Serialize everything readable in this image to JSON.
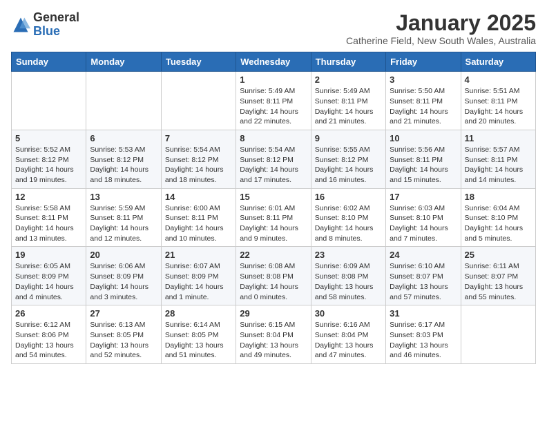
{
  "logo": {
    "general": "General",
    "blue": "Blue"
  },
  "title": "January 2025",
  "subtitle": "Catherine Field, New South Wales, Australia",
  "weekdays": [
    "Sunday",
    "Monday",
    "Tuesday",
    "Wednesday",
    "Thursday",
    "Friday",
    "Saturday"
  ],
  "weeks": [
    [
      {
        "day": null,
        "info": ""
      },
      {
        "day": null,
        "info": ""
      },
      {
        "day": null,
        "info": ""
      },
      {
        "day": "1",
        "info": "Sunrise: 5:49 AM\nSunset: 8:11 PM\nDaylight: 14 hours\nand 22 minutes."
      },
      {
        "day": "2",
        "info": "Sunrise: 5:49 AM\nSunset: 8:11 PM\nDaylight: 14 hours\nand 21 minutes."
      },
      {
        "day": "3",
        "info": "Sunrise: 5:50 AM\nSunset: 8:11 PM\nDaylight: 14 hours\nand 21 minutes."
      },
      {
        "day": "4",
        "info": "Sunrise: 5:51 AM\nSunset: 8:11 PM\nDaylight: 14 hours\nand 20 minutes."
      }
    ],
    [
      {
        "day": "5",
        "info": "Sunrise: 5:52 AM\nSunset: 8:12 PM\nDaylight: 14 hours\nand 19 minutes."
      },
      {
        "day": "6",
        "info": "Sunrise: 5:53 AM\nSunset: 8:12 PM\nDaylight: 14 hours\nand 18 minutes."
      },
      {
        "day": "7",
        "info": "Sunrise: 5:54 AM\nSunset: 8:12 PM\nDaylight: 14 hours\nand 18 minutes."
      },
      {
        "day": "8",
        "info": "Sunrise: 5:54 AM\nSunset: 8:12 PM\nDaylight: 14 hours\nand 17 minutes."
      },
      {
        "day": "9",
        "info": "Sunrise: 5:55 AM\nSunset: 8:12 PM\nDaylight: 14 hours\nand 16 minutes."
      },
      {
        "day": "10",
        "info": "Sunrise: 5:56 AM\nSunset: 8:11 PM\nDaylight: 14 hours\nand 15 minutes."
      },
      {
        "day": "11",
        "info": "Sunrise: 5:57 AM\nSunset: 8:11 PM\nDaylight: 14 hours\nand 14 minutes."
      }
    ],
    [
      {
        "day": "12",
        "info": "Sunrise: 5:58 AM\nSunset: 8:11 PM\nDaylight: 14 hours\nand 13 minutes."
      },
      {
        "day": "13",
        "info": "Sunrise: 5:59 AM\nSunset: 8:11 PM\nDaylight: 14 hours\nand 12 minutes."
      },
      {
        "day": "14",
        "info": "Sunrise: 6:00 AM\nSunset: 8:11 PM\nDaylight: 14 hours\nand 10 minutes."
      },
      {
        "day": "15",
        "info": "Sunrise: 6:01 AM\nSunset: 8:11 PM\nDaylight: 14 hours\nand 9 minutes."
      },
      {
        "day": "16",
        "info": "Sunrise: 6:02 AM\nSunset: 8:10 PM\nDaylight: 14 hours\nand 8 minutes."
      },
      {
        "day": "17",
        "info": "Sunrise: 6:03 AM\nSunset: 8:10 PM\nDaylight: 14 hours\nand 7 minutes."
      },
      {
        "day": "18",
        "info": "Sunrise: 6:04 AM\nSunset: 8:10 PM\nDaylight: 14 hours\nand 5 minutes."
      }
    ],
    [
      {
        "day": "19",
        "info": "Sunrise: 6:05 AM\nSunset: 8:09 PM\nDaylight: 14 hours\nand 4 minutes."
      },
      {
        "day": "20",
        "info": "Sunrise: 6:06 AM\nSunset: 8:09 PM\nDaylight: 14 hours\nand 3 minutes."
      },
      {
        "day": "21",
        "info": "Sunrise: 6:07 AM\nSunset: 8:09 PM\nDaylight: 14 hours\nand 1 minute."
      },
      {
        "day": "22",
        "info": "Sunrise: 6:08 AM\nSunset: 8:08 PM\nDaylight: 14 hours\nand 0 minutes."
      },
      {
        "day": "23",
        "info": "Sunrise: 6:09 AM\nSunset: 8:08 PM\nDaylight: 13 hours\nand 58 minutes."
      },
      {
        "day": "24",
        "info": "Sunrise: 6:10 AM\nSunset: 8:07 PM\nDaylight: 13 hours\nand 57 minutes."
      },
      {
        "day": "25",
        "info": "Sunrise: 6:11 AM\nSunset: 8:07 PM\nDaylight: 13 hours\nand 55 minutes."
      }
    ],
    [
      {
        "day": "26",
        "info": "Sunrise: 6:12 AM\nSunset: 8:06 PM\nDaylight: 13 hours\nand 54 minutes."
      },
      {
        "day": "27",
        "info": "Sunrise: 6:13 AM\nSunset: 8:05 PM\nDaylight: 13 hours\nand 52 minutes."
      },
      {
        "day": "28",
        "info": "Sunrise: 6:14 AM\nSunset: 8:05 PM\nDaylight: 13 hours\nand 51 minutes."
      },
      {
        "day": "29",
        "info": "Sunrise: 6:15 AM\nSunset: 8:04 PM\nDaylight: 13 hours\nand 49 minutes."
      },
      {
        "day": "30",
        "info": "Sunrise: 6:16 AM\nSunset: 8:04 PM\nDaylight: 13 hours\nand 47 minutes."
      },
      {
        "day": "31",
        "info": "Sunrise: 6:17 AM\nSunset: 8:03 PM\nDaylight: 13 hours\nand 46 minutes."
      },
      {
        "day": null,
        "info": ""
      }
    ]
  ]
}
